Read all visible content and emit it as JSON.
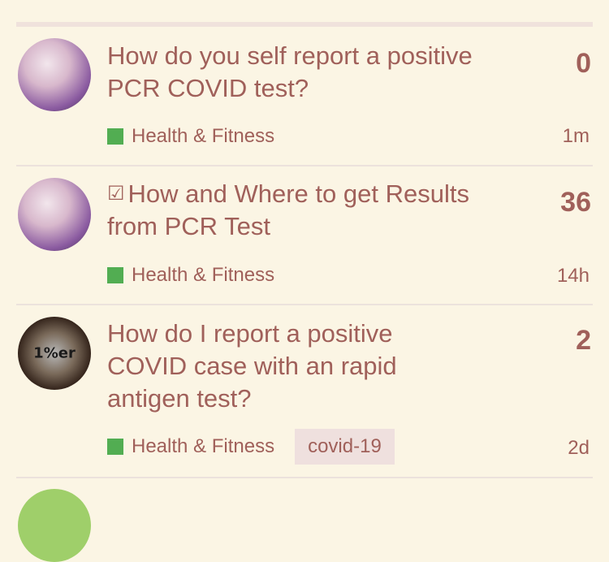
{
  "topics": [
    {
      "title": "How do you self report a positive PCR COVID test?",
      "count": "0",
      "category": "Health & Fitness",
      "category_color": "#52ad52",
      "age": "1m",
      "avatar": "user-avatar"
    },
    {
      "pinned_icon": "☑",
      "title": "How and Where to get Results from PCR Test",
      "count": "36",
      "category": "Health & Fitness",
      "category_color": "#52ad52",
      "age": "14h",
      "avatar": "user-avatar"
    },
    {
      "title": "How do I report a positive COVID case with an rapid antigen test?",
      "count": "2",
      "category": "Health & Fitness",
      "category_color": "#52ad52",
      "tag": "covid-19",
      "age": "2d",
      "avatar": "user-avatar",
      "avatar_text": "1%er"
    }
  ]
}
